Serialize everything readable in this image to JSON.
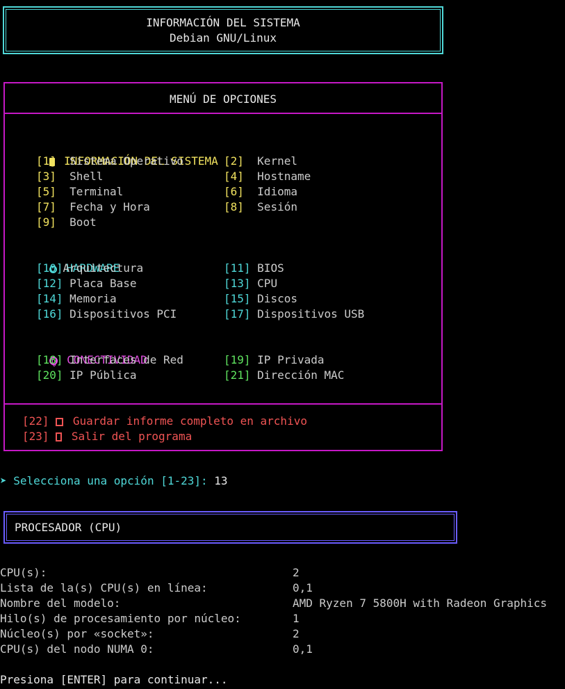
{
  "header": {
    "title": "INFORMACIÓN DEL SISTEMA",
    "subtitle": "Debian GNU/Linux"
  },
  "menu": {
    "title": "MENÚ DE OPCIONES",
    "sections": [
      {
        "title": "INFORMACIÓN DEL SISTEMA",
        "icon": "document-icon",
        "color": "#f1e25f",
        "items": [
          {
            "key": "[1]",
            "label": "Sistema Operativo"
          },
          {
            "key": "[2]",
            "label": "Kernel"
          },
          {
            "key": "[3]",
            "label": "Shell"
          },
          {
            "key": "[4]",
            "label": "Hostname"
          },
          {
            "key": "[5]",
            "label": "Terminal"
          },
          {
            "key": "[6]",
            "label": "Idioma"
          },
          {
            "key": "[7]",
            "label": "Fecha y Hora"
          },
          {
            "key": "[8]",
            "label": "Sesión"
          },
          {
            "key": "[9]",
            "label": "Boot"
          }
        ]
      },
      {
        "title": "HARDWARE",
        "icon": "gear-icon",
        "color": "#4fd8d8",
        "items": [
          {
            "key": "[10]",
            "label": "Arquitectura"
          },
          {
            "key": "[11]",
            "label": "BIOS"
          },
          {
            "key": "[12]",
            "label": "Placa Base"
          },
          {
            "key": "[13]",
            "label": "CPU"
          },
          {
            "key": "[14]",
            "label": "Memoria"
          },
          {
            "key": "[15]",
            "label": "Discos"
          },
          {
            "key": "[16]",
            "label": "Dispositivos PCI"
          },
          {
            "key": "[17]",
            "label": "Dispositivos USB"
          }
        ]
      },
      {
        "title": "CONECTIVIDAD",
        "icon": "globe-icon",
        "color": "#e34fe3",
        "items": [
          {
            "key": "[18]",
            "label": "Interfaces de Red"
          },
          {
            "key": "[19]",
            "label": "IP Privada"
          },
          {
            "key": "[20]",
            "label": "IP Pública"
          },
          {
            "key": "[21]",
            "label": "Dirección MAC"
          }
        ]
      }
    ],
    "actions": [
      {
        "key": "[22]",
        "icon": "floppy-disk-icon",
        "label": "Guardar informe completo en archivo"
      },
      {
        "key": "[23]",
        "icon": "door-icon",
        "label": "Salir del programa"
      }
    ]
  },
  "prompt": {
    "arrow": "➤",
    "text": "Selecciona una opción [1-23]:",
    "value": "13"
  },
  "result": {
    "title": "PROCESADOR (CPU)",
    "rows": [
      {
        "label": "CPU(s):",
        "value": "2"
      },
      {
        "label": "Lista de la(s) CPU(s) en línea:",
        "value": "0,1"
      },
      {
        "label": "Nombre del modelo:",
        "value": "AMD Ryzen 7 5800H with Radeon Graphics"
      },
      {
        "label": "Hilo(s) de procesamiento por núcleo:",
        "value": "1"
      },
      {
        "label": "Núcleo(s) por «socket»:",
        "value": "2"
      },
      {
        "label": "CPU(s) del nodo NUMA 0:",
        "value": "0,1"
      }
    ],
    "continue": "Presiona [ENTER] para continuar..."
  },
  "colors": {
    "header_border": "#4fd8d8",
    "menu_border": "#c518c5",
    "result_border": "#6a5cff",
    "prompt": "#4fd8d8",
    "actions": "#f05454",
    "connectivity_keys": "#5fe35f"
  }
}
